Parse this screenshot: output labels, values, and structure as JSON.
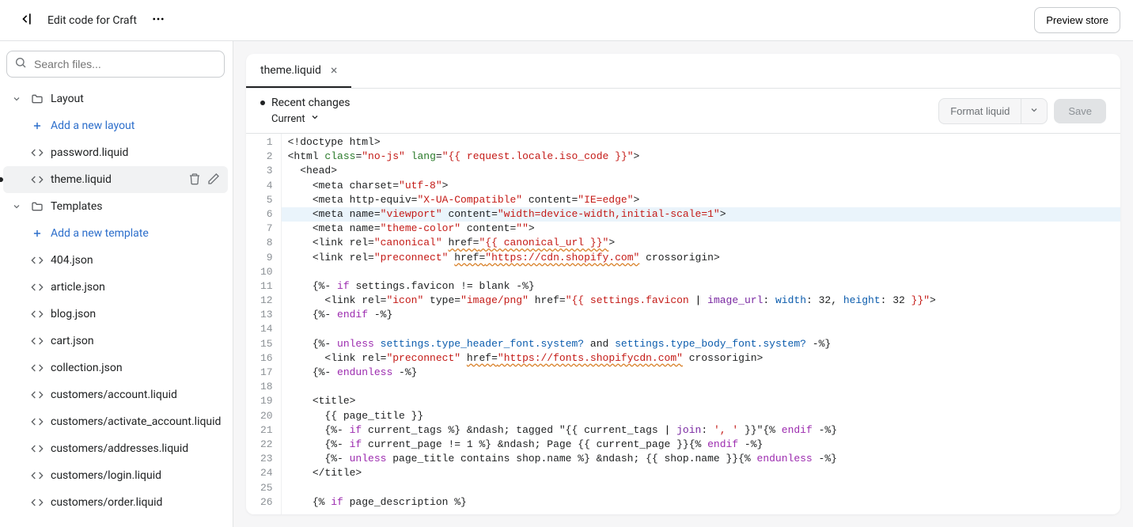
{
  "header": {
    "title": "Edit code for Craft",
    "preview_label": "Preview store"
  },
  "search": {
    "placeholder": "Search files..."
  },
  "sidebar": {
    "layout_label": "Layout",
    "add_layout_label": "Add a new layout",
    "layout_files": [
      {
        "name": "password.liquid"
      },
      {
        "name": "theme.liquid",
        "selected": true
      }
    ],
    "templates_label": "Templates",
    "add_template_label": "Add a new template",
    "template_files": [
      {
        "name": "404.json"
      },
      {
        "name": "article.json"
      },
      {
        "name": "blog.json"
      },
      {
        "name": "cart.json"
      },
      {
        "name": "collection.json"
      },
      {
        "name": "customers/account.liquid"
      },
      {
        "name": "customers/activate_account.liquid"
      },
      {
        "name": "customers/addresses.liquid"
      },
      {
        "name": "customers/login.liquid"
      },
      {
        "name": "customers/order.liquid"
      }
    ]
  },
  "tab": {
    "name": "theme.liquid"
  },
  "toolbar": {
    "recent_label": "Recent changes",
    "version_label": "Current",
    "format_label": "Format liquid",
    "save_label": "Save"
  }
}
